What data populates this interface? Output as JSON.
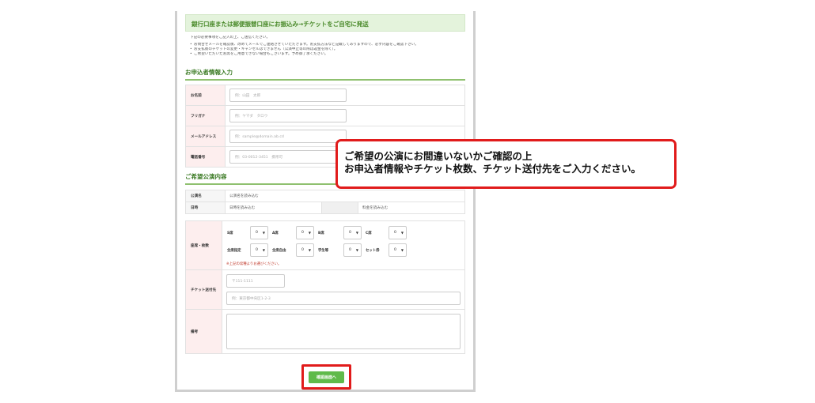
{
  "banner": {
    "title": "銀行口座または郵便振替口座にお振込み→チケットをご自宅に発送"
  },
  "intro": {
    "lead": "下記の必要事項をご記入の上、ご送信ください。",
    "bullets": [
      "お問合せメールを確認後、改めてメールでご連絡させていただきます。お支払方法など記載してありますので、必ず内容をご確認下さい。",
      "お支払後のチケットの変更・キャンセルはできません（公演中止等の際は返金を除く）。",
      "ご希望いただいたお席をご用意できない場合もございます。予め御了承ください。"
    ]
  },
  "applicant": {
    "section_title": "お申込者情報入力",
    "fields": [
      {
        "label": "お名前",
        "placeholder": "例：山田　太郎"
      },
      {
        "label": "フリガナ",
        "placeholder": "例：ヤマダ　タロウ"
      },
      {
        "label": "メールアドレス",
        "placeholder": "例：sample@domain.ab.cd"
      },
      {
        "label": "電話番号",
        "placeholder": "例：03-0012-3451　携帯可"
      }
    ]
  },
  "performance": {
    "section_title": "ご希望公演内容",
    "title_label": "公演名",
    "title_value": "公演名を読み込む",
    "date_label": "日時",
    "date_value": "日時を読み込む",
    "price_value": "料金を読み込む"
  },
  "seats": {
    "label": "座席・枚数",
    "items": [
      {
        "name": "S席",
        "value": "0"
      },
      {
        "name": "A席",
        "value": "0"
      },
      {
        "name": "B席",
        "value": "0"
      },
      {
        "name": "C席",
        "value": "0"
      },
      {
        "name": "全席指定",
        "value": "0"
      },
      {
        "name": "全席自由",
        "value": "0"
      },
      {
        "name": "学生等",
        "value": "0"
      },
      {
        "name": "セット券",
        "value": "0"
      }
    ],
    "note": "※上記の席種よりお選びください。"
  },
  "delivery": {
    "label": "チケット送付先",
    "zip_placeholder": "〒111-1111",
    "address_placeholder": "例：東京都中央区1-2-3"
  },
  "remarks": {
    "label": "備考"
  },
  "submit": {
    "label": "確認画面へ"
  },
  "callout": {
    "line1": "ご希望の公演にお間違いないかご確認の上",
    "line2": "お申込者情報やチケット枚数、チケット送付先をご入力ください。"
  }
}
